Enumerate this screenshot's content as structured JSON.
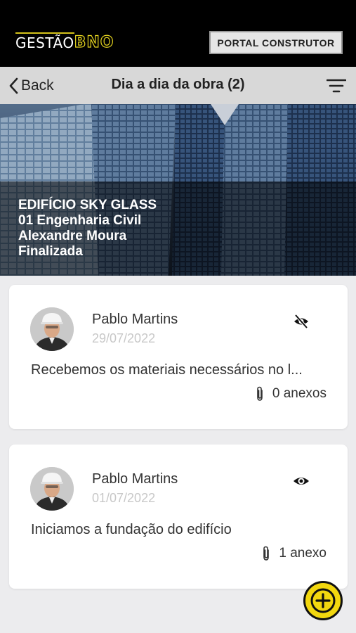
{
  "header": {
    "logo_text_main": "GESTÃO",
    "logo_text_accent": "BNO",
    "portal_button_label": "PORTAL CONSTRUTOR"
  },
  "nav": {
    "back_label": "Back",
    "title": "Dia a dia da obra (2)"
  },
  "project": {
    "name": "EDIFÍCIO SKY GLASS",
    "stage": "01 Engenharia Civil",
    "responsible": "Alexandre Moura",
    "status": "Finalizada"
  },
  "entries": [
    {
      "author": "Pablo Martins",
      "date": "29/07/2022",
      "message": "Recebemos os materiais necessários no l...",
      "attachments": "0 anexos",
      "visibility_icon": "eye-off-icon"
    },
    {
      "author": "Pablo Martins",
      "date": "01/07/2022",
      "message": "Iniciamos a fundação do edifício",
      "attachments": "1 anexo",
      "visibility_icon": "eye-icon"
    }
  ],
  "colors": {
    "accent": "#f2d70f",
    "topbar": "#000000",
    "navbar": "#d8d8d8",
    "background": "#ececee"
  }
}
